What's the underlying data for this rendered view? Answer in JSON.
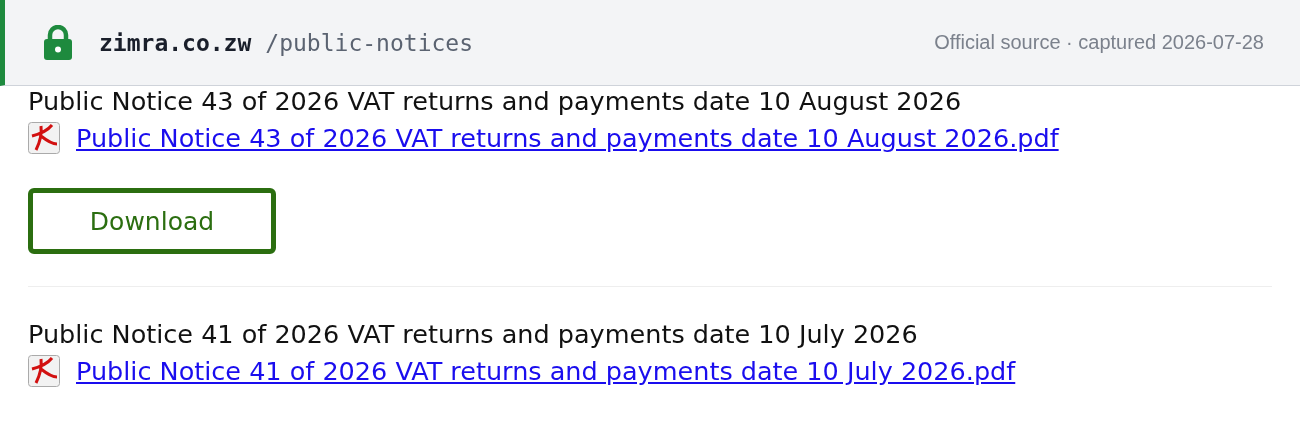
{
  "header": {
    "domain": "zimra.co.zw",
    "path": "/public-notices",
    "source_note": "Official source · captured 2026-07-28"
  },
  "notices": [
    {
      "title": "Public Notice 43 of 2026 VAT returns and payments date 10 August 2026",
      "file_link": "Public Notice 43 of 2026 VAT returns and payments date 10 August 2026.pdf",
      "button": "Download"
    },
    {
      "title": "Public Notice 41 of 2026 VAT returns and payments date 10 July 2026",
      "file_link": "Public Notice 41 of 2026 VAT returns and payments date 10 July 2026.pdf"
    }
  ]
}
